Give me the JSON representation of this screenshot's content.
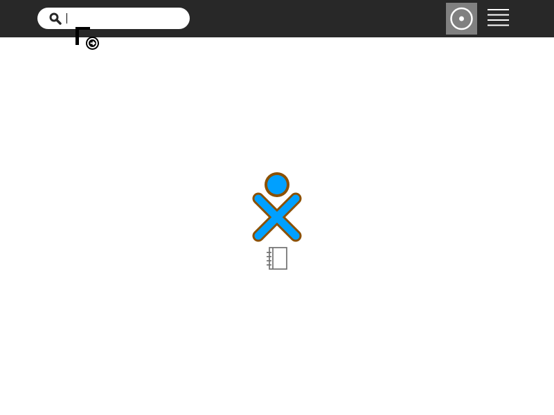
{
  "toolbar": {
    "background": "#282828"
  },
  "search": {
    "value": "",
    "placeholder": "",
    "icon": "search-icon",
    "clear_icon": "clear-search-icon"
  },
  "view_buttons": {
    "journal": {
      "icon": "journal-view-icon",
      "selected": true,
      "background": "#808080"
    },
    "list": {
      "icon": "list-view-icon",
      "selected": false
    }
  },
  "home": {
    "owner_icon": "xo-owner-icon",
    "owner_colors": {
      "stroke": "#8b5000",
      "fill": "#00a0ff"
    },
    "activity_icon": "journal-activity-icon",
    "activity_color": "#707070"
  }
}
